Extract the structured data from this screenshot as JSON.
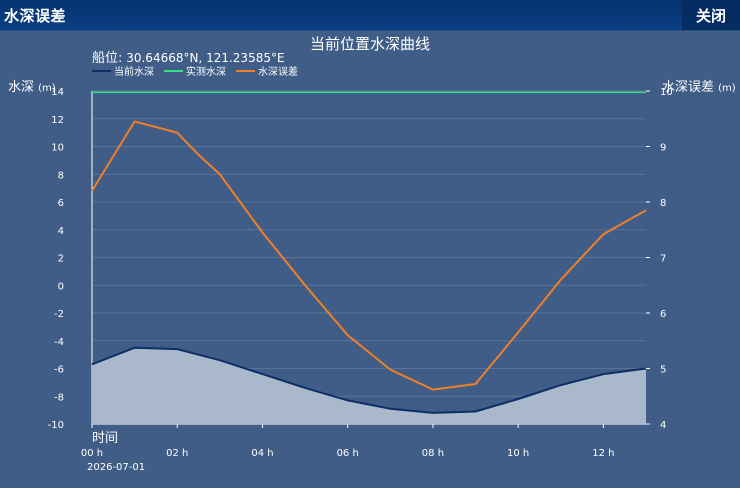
{
  "window": {
    "title": "水深误差",
    "close_label": "关闭"
  },
  "chart_data": {
    "type": "line",
    "title": "当前位置水深曲线",
    "subtitle_label": "船位:",
    "subtitle_value": "30.64668°N, 121.23585°E",
    "x_axis": {
      "title": "时间",
      "date_label": "2026-07-01",
      "tick_labels": [
        "00 h",
        "02 h",
        "04 h",
        "06 h",
        "08 h",
        "10 h",
        "12 h"
      ],
      "ticks": [
        0,
        2,
        4,
        6,
        8,
        10,
        12
      ],
      "range": [
        0,
        13
      ]
    },
    "y_left": {
      "title": "水深",
      "unit": "(m)",
      "range": [
        -10,
        14
      ],
      "ticks": [
        -10,
        -8,
        -6,
        -4,
        -2,
        0,
        2,
        4,
        6,
        8,
        10,
        12,
        14
      ]
    },
    "y_right": {
      "title": "水深误差",
      "unit": "(m)",
      "range": [
        4,
        10
      ],
      "ticks": [
        4,
        5,
        6,
        7,
        8,
        9,
        10
      ]
    },
    "grid": true,
    "legend_position": "top-left",
    "series": [
      {
        "name": "当前水深",
        "axis": "left",
        "color": "#0d2f66",
        "fill": "#aab8cc",
        "x": [
          0,
          1,
          2,
          3,
          4,
          5,
          6,
          7,
          8,
          9,
          10,
          11,
          12,
          13
        ],
        "y": [
          -5.7,
          -4.5,
          -4.6,
          -5.4,
          -6.4,
          -7.4,
          -8.3,
          -8.9,
          -9.2,
          -9.1,
          -8.2,
          -7.2,
          -6.4,
          -6.0
        ]
      },
      {
        "name": "实测水深",
        "axis": "left",
        "color": "#3ddc84",
        "x": [
          0,
          13
        ],
        "y": [
          13.9,
          13.9
        ]
      },
      {
        "name": "水深误差",
        "axis": "right",
        "color": "#ef7f2a",
        "x": [
          0,
          1,
          2,
          2.5,
          3,
          4,
          5,
          6,
          7,
          8,
          9,
          10,
          11,
          12,
          13
        ],
        "y": [
          8.2,
          9.45,
          9.25,
          8.85,
          8.5,
          7.45,
          6.5,
          5.6,
          4.98,
          4.62,
          4.72,
          5.65,
          6.6,
          7.42,
          7.85
        ]
      }
    ]
  }
}
